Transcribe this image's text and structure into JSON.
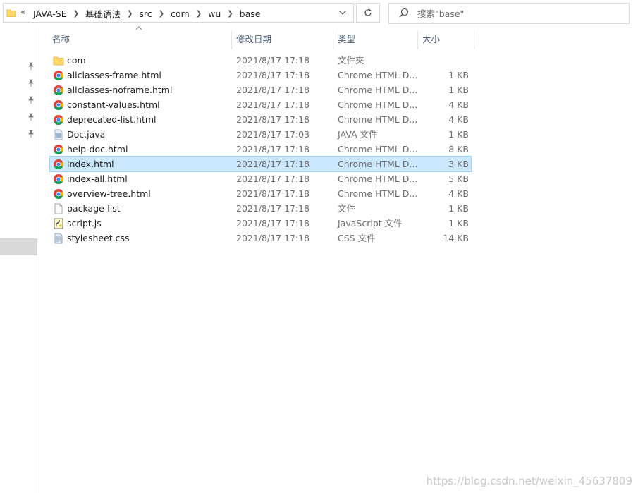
{
  "address": {
    "crumbs": [
      "JAVA-SE",
      "基础语法",
      "src",
      "com",
      "wu",
      "base"
    ],
    "prefix": "«"
  },
  "search": {
    "placeholder": "搜索\"base\""
  },
  "columns": {
    "name": "名称",
    "date": "修改日期",
    "type": "类型",
    "size": "大小"
  },
  "files": [
    {
      "name": "com",
      "date": "2021/8/17 17:18",
      "type": "文件夹",
      "size": "",
      "icon": "folder-icon"
    },
    {
      "name": "allclasses-frame.html",
      "date": "2021/8/17 17:18",
      "type": "Chrome HTML D...",
      "size": "1 KB",
      "icon": "chrome-icon"
    },
    {
      "name": "allclasses-noframe.html",
      "date": "2021/8/17 17:18",
      "type": "Chrome HTML D...",
      "size": "1 KB",
      "icon": "chrome-icon"
    },
    {
      "name": "constant-values.html",
      "date": "2021/8/17 17:18",
      "type": "Chrome HTML D...",
      "size": "4 KB",
      "icon": "chrome-icon"
    },
    {
      "name": "deprecated-list.html",
      "date": "2021/8/17 17:18",
      "type": "Chrome HTML D...",
      "size": "4 KB",
      "icon": "chrome-icon"
    },
    {
      "name": "Doc.java",
      "date": "2021/8/17 17:03",
      "type": "JAVA 文件",
      "size": "1 KB",
      "icon": "java-file-icon"
    },
    {
      "name": "help-doc.html",
      "date": "2021/8/17 17:18",
      "type": "Chrome HTML D...",
      "size": "8 KB",
      "icon": "chrome-icon"
    },
    {
      "name": "index.html",
      "date": "2021/8/17 17:18",
      "type": "Chrome HTML D...",
      "size": "3 KB",
      "icon": "chrome-icon",
      "selected": true
    },
    {
      "name": "index-all.html",
      "date": "2021/8/17 17:18",
      "type": "Chrome HTML D...",
      "size": "5 KB",
      "icon": "chrome-icon"
    },
    {
      "name": "overview-tree.html",
      "date": "2021/8/17 17:18",
      "type": "Chrome HTML D...",
      "size": "4 KB",
      "icon": "chrome-icon"
    },
    {
      "name": "package-list",
      "date": "2021/8/17 17:18",
      "type": "文件",
      "size": "1 KB",
      "icon": "blank-file-icon"
    },
    {
      "name": "script.js",
      "date": "2021/8/17 17:18",
      "type": "JavaScript 文件",
      "size": "1 KB",
      "icon": "script-file-icon"
    },
    {
      "name": "stylesheet.css",
      "date": "2021/8/17 17:18",
      "type": "CSS 文件",
      "size": "14 KB",
      "icon": "css-file-icon"
    }
  ],
  "watermark": "https://blog.csdn.net/weixin_45637809",
  "colors": {
    "selection": "#cce8ff",
    "selection_border": "#99d1ff",
    "header_text": "#4c607a"
  }
}
